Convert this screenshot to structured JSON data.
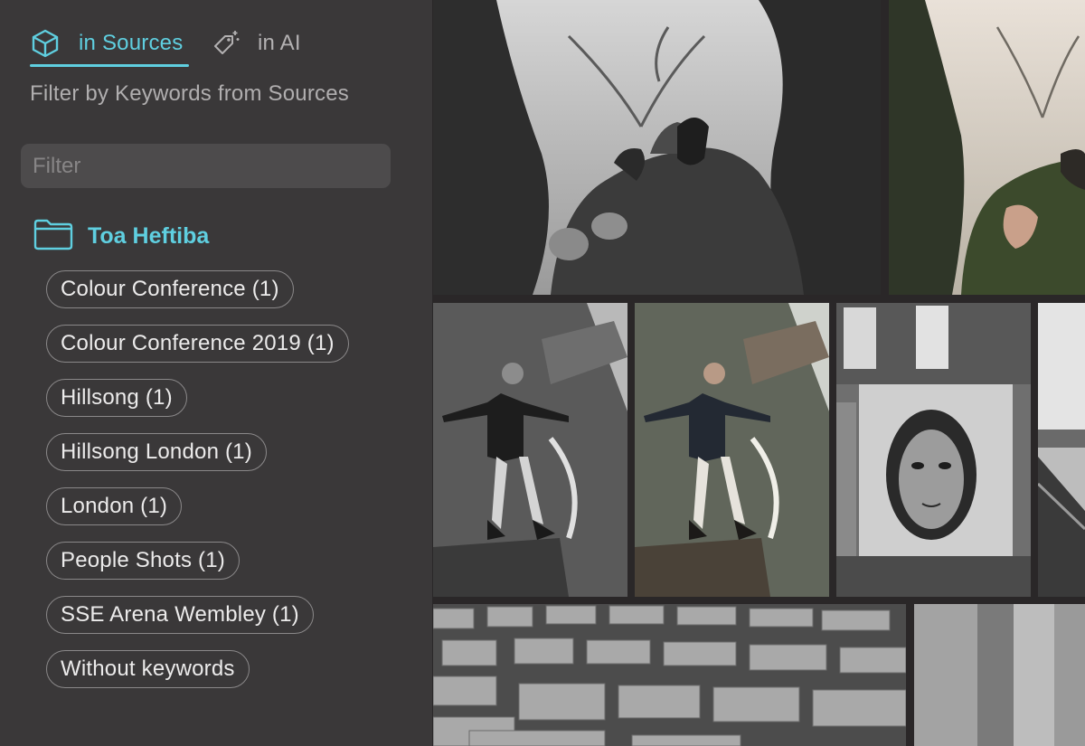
{
  "sidebar": {
    "tabs": [
      {
        "label": "in Sources",
        "icon": "cube-icon",
        "active": true
      },
      {
        "label": "in AI",
        "icon": "magic-tag-icon",
        "active": false
      }
    ],
    "subtitle": "Filter by Keywords from Sources",
    "filter_placeholder": "Filter",
    "folder": {
      "label": "Toa Heftiba",
      "icon": "folder-icon"
    },
    "keywords": [
      "Colour Conference (1)",
      "Colour Conference 2019 (1)",
      "Hillsong (1)",
      "Hillsong London (1)",
      "London (1)",
      "People Shots (1)",
      "SSE Arena Wembley (1)",
      "Without keywords"
    ]
  },
  "colors": {
    "accent": "#5fcfe0",
    "sidebar_bg": "#3a3839",
    "grid_bg": "#2a2728"
  },
  "photos": [
    "couple-trees-bw",
    "couple-trees-color",
    "man-on-wall-bw",
    "man-on-wall-color",
    "mural-woman-face",
    "city-skyline",
    "concrete-blocks",
    "concrete-wall"
  ]
}
